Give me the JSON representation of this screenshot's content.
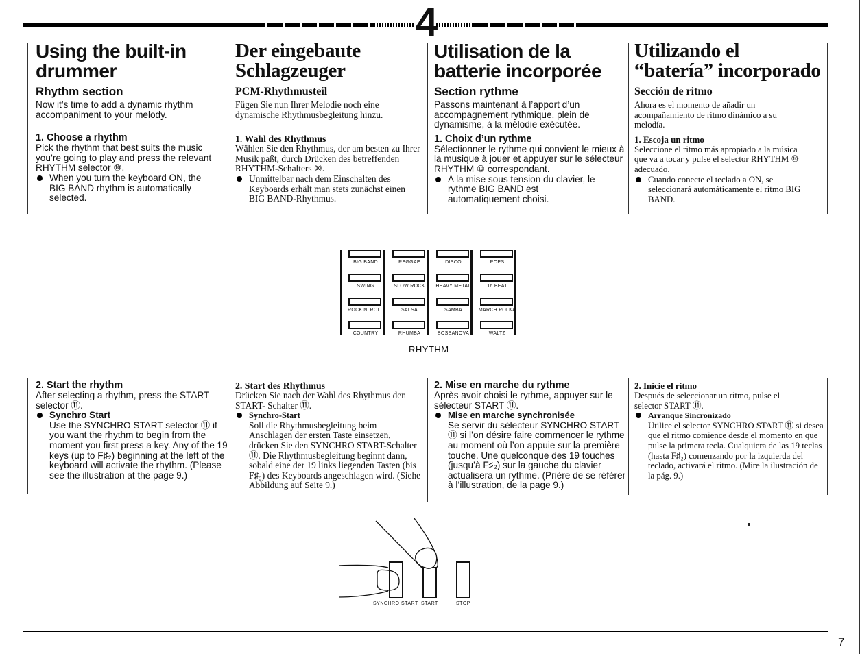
{
  "header": {
    "chapter_number": "4"
  },
  "top": {
    "en": {
      "title": "Using the built-in drummer",
      "subtitle": "Rhythm section",
      "intro": "Now it’s time to add a dynamic rhythm accompaniment to your melody.",
      "step_heading": "1. Choose a rhythm",
      "step_body": "Pick the rhythm that best suits the music you’re going to play and press the relevant RHYTHM selector ⑩.",
      "bullet": "When you turn the keyboard ON, the BIG BAND rhythm is automatically selected."
    },
    "de": {
      "title": "Der eingebaute Schlagzeuger",
      "subtitle": "PCM-Rhythmusteil",
      "intro": "Fügen Sie nun Ihrer Melodie noch eine dynamische Rhythmusbegleitung hinzu.",
      "step_heading": "1. Wahl des Rhythmus",
      "step_body": "Wählen Sie den Rhythmus, der am besten zu Ihrer Musik paßt, durch Drücken des betreffenden RHYTHM-Schalters ⑩.",
      "bullet": "Unmittelbar nach dem Einschalten des Keyboards erhält man stets zunächst einen BIG BAND-Rhythmus."
    },
    "fr": {
      "title": "Utilisation de la batterie incorporée",
      "subtitle": "Section rythme",
      "intro": "Passons maintenant à l’apport d’un accompagnement rythmique, plein de dynamisme, à la mélodie exécutée.",
      "step_heading": "1. Choix d’un rythme",
      "step_body": "Sélectionner le rythme qui convient le mieux à la musique à jouer et appuyer sur le sélecteur RHYTHM ⑩ correspondant.",
      "bullet": "A la mise sous tension du clavier, le rythme BIG BAND est automatiquement choisi."
    },
    "es": {
      "title": "Utilizando el “batería” incorporado",
      "subtitle": "Sección de ritmo",
      "intro": "Ahora es el momento de añadir un acompañamiento de ritmo dinámico a su melodía.",
      "step_heading": "1. Escoja un ritmo",
      "step_body": "Seleccione el ritmo más apropiado a la música que va a tocar y pulse el selector RHYTHM ⑩ adecuado.",
      "bullet": "Cuando conecte el teclado a ON, se seleccionará automáticamente el ritmo BIG BAND."
    }
  },
  "rhythm_panel": {
    "caption": "RHYTHM",
    "columns": [
      [
        "BIG BAND",
        "SWING",
        "ROCK’N’ ROLL",
        "COUNTRY"
      ],
      [
        "REGGAE",
        "SLOW ROCK",
        "SALSA",
        "RHUMBA"
      ],
      [
        "DISCO",
        "HEAVY METAL",
        "SAMBA",
        "BOSSANOVA"
      ],
      [
        "POPS",
        "16 BEAT",
        "MARCH POLKA",
        "WALTZ"
      ]
    ]
  },
  "bottom": {
    "en": {
      "step_heading": "2. Start the rhythm",
      "step_body": "After selecting a rhythm, press the START selector ⑪.",
      "bullet_title": "Synchro Start",
      "bullet_body": "Use the SYNCHRO START selector ⑪ if you want the rhythm to begin from the moment you first press a key. Any of the 19 keys (up to F♯₂) beginning at the left of the keyboard will activate the rhythm. (Please see the illustration at the page 9.)"
    },
    "de": {
      "step_heading": "2. Start des Rhythmus",
      "step_body": "Drücken Sie nach der Wahl des Rhythmus den START- Schalter ⑪.",
      "bullet_title": "Synchro-Start",
      "bullet_body": "Soll die Rhythmusbegleitung beim Anschlagen der ersten Taste einsetzen, drücken Sie den SYNCHRO START-Schalter ⑪. Die Rhythmusbegleitung beginnt dann, sobald eine der 19 links liegenden Tasten (bis F♯₂) des Keyboards angeschlagen wird. (Siehe Abbildung auf Seite 9.)"
    },
    "fr": {
      "step_heading": "2. Mise en marche du rythme",
      "step_body": "Après avoir choisi le rythme, appuyer sur le sélecteur START ⑪.",
      "bullet_title": "Mise en marche synchronisée",
      "bullet_body": "Se servir du sélecteur SYNCHRO START ⑪ si l’on désire faire commencer le rythme au moment où l’on appuie sur la première touche. Une quelconque des 19 touches (jusqu’à F♯₂) sur la gauche du clavier actualisera un rythme. (Prière de se référer à l’illustration, de la page 9.)"
    },
    "es": {
      "step_heading": "2. Inicie el ritmo",
      "step_body": "Después de seleccionar un ritmo, pulse el selector START ⑪.",
      "bullet_title": "Arranque Sincronizado",
      "bullet_body": "Utilice el selector SYNCHRO START ⑪ si desea que el ritmo comience desde el momento en que pulse la primera tecla. Cualquiera de las 19 teclas (hasta F♯₂) comenzando por la izquierda del teclado, activará el ritmo. (Mire la ilustración de la pág. 9.)"
    }
  },
  "illustration": {
    "labels": {
      "synchro_start": "SYNCHRO START",
      "start": "START",
      "stop": "STOP"
    }
  },
  "footer": {
    "page_number": "7"
  }
}
